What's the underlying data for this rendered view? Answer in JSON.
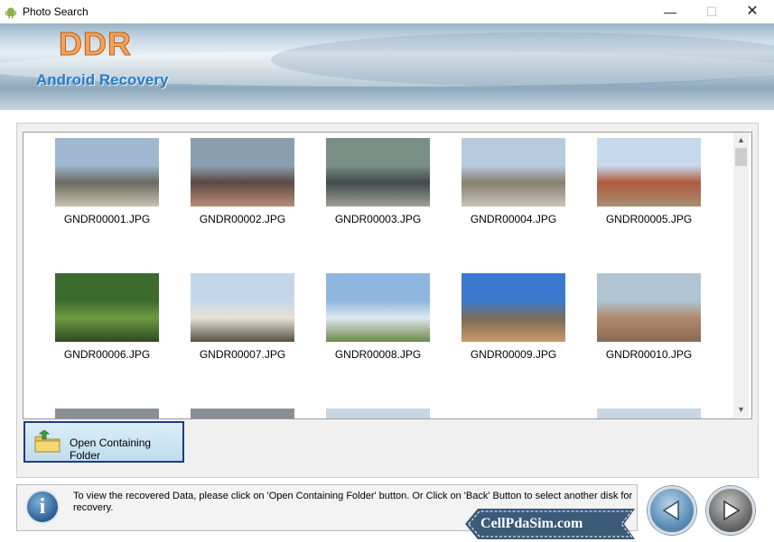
{
  "window": {
    "title": "Photo Search",
    "minimize_glyph": "—",
    "maximize_glyph": "☐",
    "close_glyph": "✕"
  },
  "banner": {
    "brand": "DDR",
    "product": "Android Recovery"
  },
  "gallery": {
    "items": [
      {
        "label": "GNDR00001.JPG",
        "colors": [
          "#9fb7cf",
          "#6a6a60",
          "#c9c2b0"
        ]
      },
      {
        "label": "GNDR00002.JPG",
        "colors": [
          "#8aa0b0",
          "#5b4a44",
          "#b98d78"
        ]
      },
      {
        "label": "GNDR00003.JPG",
        "colors": [
          "#7a8f85",
          "#3f4a4a",
          "#a0a098"
        ]
      },
      {
        "label": "GNDR00004.JPG",
        "colors": [
          "#b7cbe0",
          "#8a8070",
          "#c8c4b8"
        ]
      },
      {
        "label": "GNDR00005.JPG",
        "colors": [
          "#c7d9ec",
          "#b05a3e",
          "#a88e74"
        ]
      },
      {
        "label": "GNDR00006.JPG",
        "colors": [
          "#3d6b2e",
          "#6e9a42",
          "#2c4a22"
        ]
      },
      {
        "label": "GNDR00007.JPG",
        "colors": [
          "#c4d6ea",
          "#e8e2d6",
          "#5a5040"
        ]
      },
      {
        "label": "GNDR00008.JPG",
        "colors": [
          "#8fb6de",
          "#dfe8f0",
          "#6b8a4a"
        ]
      },
      {
        "label": "GNDR00009.JPG",
        "colors": [
          "#3a7bd0",
          "#7a6a5a",
          "#c89a66"
        ]
      },
      {
        "label": "GNDR00010.JPG",
        "colors": [
          "#b0c4d4",
          "#b08a6e",
          "#8a6a52"
        ]
      }
    ]
  },
  "actions": {
    "open_folder_label": "Open Containing Folder"
  },
  "info": {
    "message": "To view the recovered Data, please click on 'Open Containing Folder' button. Or Click on 'Back' Button to select another disk for recovery."
  },
  "watermark": {
    "site": "CellPdaSim.com"
  },
  "icons": {
    "app": "android-icon",
    "info": "info-icon",
    "folder": "folder-icon",
    "back": "back-arrow-icon",
    "next": "next-arrow-icon"
  }
}
